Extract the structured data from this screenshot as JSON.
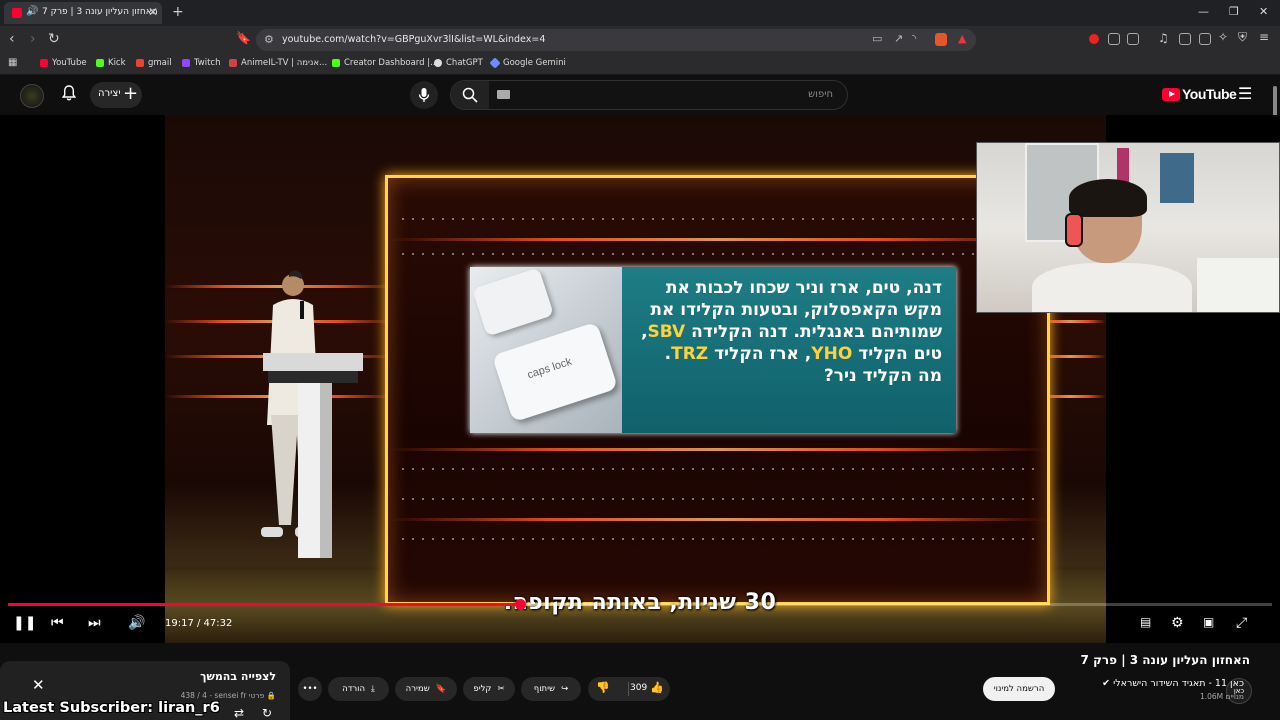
{
  "browser": {
    "tab_title": "האחזון העליון עונה 3 | פרק 7",
    "address": "youtube.com/watch?v=GBPguXvr3lI&list=WL&index=4",
    "bookmarks": [
      "YouTube",
      "Kick",
      "gmail",
      "Twitch",
      "AnimeIL-TV | אנימה...",
      "Creator Dashboard |...",
      "ChatGPT",
      "Google Gemini"
    ]
  },
  "header": {
    "create_label": "יצירה",
    "search_placeholder": "חיפוש",
    "logo_text": "YouTube"
  },
  "video": {
    "card_lines": [
      "דנה, טים, ארז וניר שכחו לכבות את",
      "מקש הקאפסלוק, ובטעות הקלידו את",
      "שמותיהם באנגלית. דנה הקלידה",
      "טים הקליד",
      "ארז הקליד",
      "מה הקליד ניר?"
    ],
    "card_codes": [
      "SBV",
      "YHO",
      "TRZ"
    ],
    "key_label": "caps lock",
    "subtitle": "30 שניות, באותה תקופה.",
    "time": "19:17 / 47:32",
    "progress": 0.405,
    "buffered": 0.47
  },
  "below": {
    "title": "האחזון העליון עונה 3 | פרק 7",
    "channel_icon": "כאן",
    "channel_name": "כאן 11 - תאגיד השידור הישראלי",
    "subscribers": "1.06M מנויים",
    "subscribe_label": "הרשמה למינוי",
    "likes": "309",
    "share_label": "שיתוף",
    "clip_label": "קליפ",
    "save_label": "שמירה",
    "download_label": "הורדה"
  },
  "playlist": {
    "title": "לצפייה בהמשך",
    "meta": "438 / 4 - sensei fr פרטי"
  },
  "overlay": {
    "latest_subscriber": "Latest Subscriber: liran_r6"
  },
  "colors": {
    "accent": "#ff0033",
    "stage_frame": "#ffd34a",
    "card_teal": "#1e7d86",
    "code_yellow": "#ffd23a"
  }
}
